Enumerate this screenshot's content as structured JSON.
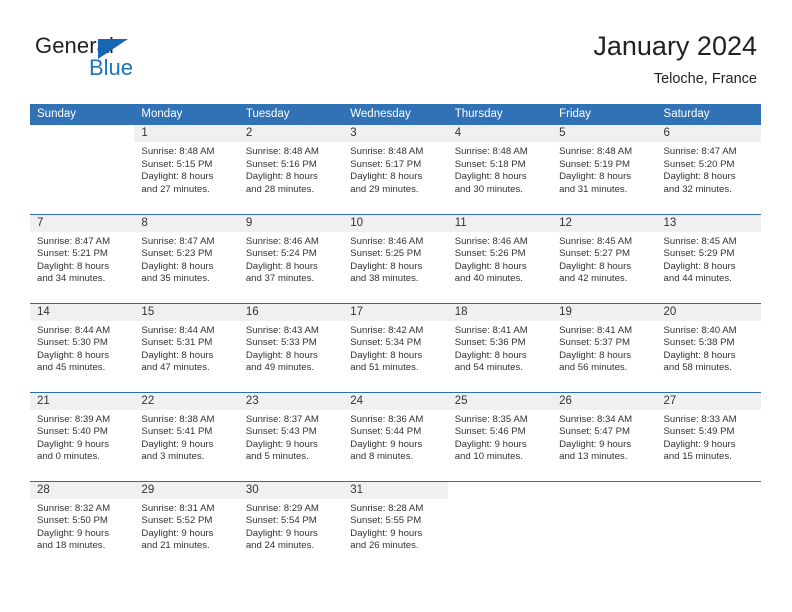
{
  "brand": {
    "name_primary": "General",
    "name_secondary": "Blue",
    "flag_color": "#1667b2",
    "secondary_color": "#1b75bb"
  },
  "header": {
    "title": "January 2024",
    "location": "Teloche, France"
  },
  "theme": {
    "header_row_bg": "#3072b5",
    "row_border": "#2a6db4",
    "daynum_band_bg": "#f0f0f0",
    "text_color": "#333333"
  },
  "weekday_headers": [
    "Sunday",
    "Monday",
    "Tuesday",
    "Wednesday",
    "Thursday",
    "Friday",
    "Saturday"
  ],
  "weeks": [
    [
      {
        "day": "",
        "sunrise": "",
        "sunset": "",
        "daylight_line1": "",
        "daylight_line2": ""
      },
      {
        "day": "1",
        "sunrise": "Sunrise: 8:48 AM",
        "sunset": "Sunset: 5:15 PM",
        "daylight_line1": "Daylight: 8 hours",
        "daylight_line2": "and 27 minutes."
      },
      {
        "day": "2",
        "sunrise": "Sunrise: 8:48 AM",
        "sunset": "Sunset: 5:16 PM",
        "daylight_line1": "Daylight: 8 hours",
        "daylight_line2": "and 28 minutes."
      },
      {
        "day": "3",
        "sunrise": "Sunrise: 8:48 AM",
        "sunset": "Sunset: 5:17 PM",
        "daylight_line1": "Daylight: 8 hours",
        "daylight_line2": "and 29 minutes."
      },
      {
        "day": "4",
        "sunrise": "Sunrise: 8:48 AM",
        "sunset": "Sunset: 5:18 PM",
        "daylight_line1": "Daylight: 8 hours",
        "daylight_line2": "and 30 minutes."
      },
      {
        "day": "5",
        "sunrise": "Sunrise: 8:48 AM",
        "sunset": "Sunset: 5:19 PM",
        "daylight_line1": "Daylight: 8 hours",
        "daylight_line2": "and 31 minutes."
      },
      {
        "day": "6",
        "sunrise": "Sunrise: 8:47 AM",
        "sunset": "Sunset: 5:20 PM",
        "daylight_line1": "Daylight: 8 hours",
        "daylight_line2": "and 32 minutes."
      }
    ],
    [
      {
        "day": "7",
        "sunrise": "Sunrise: 8:47 AM",
        "sunset": "Sunset: 5:21 PM",
        "daylight_line1": "Daylight: 8 hours",
        "daylight_line2": "and 34 minutes."
      },
      {
        "day": "8",
        "sunrise": "Sunrise: 8:47 AM",
        "sunset": "Sunset: 5:23 PM",
        "daylight_line1": "Daylight: 8 hours",
        "daylight_line2": "and 35 minutes."
      },
      {
        "day": "9",
        "sunrise": "Sunrise: 8:46 AM",
        "sunset": "Sunset: 5:24 PM",
        "daylight_line1": "Daylight: 8 hours",
        "daylight_line2": "and 37 minutes."
      },
      {
        "day": "10",
        "sunrise": "Sunrise: 8:46 AM",
        "sunset": "Sunset: 5:25 PM",
        "daylight_line1": "Daylight: 8 hours",
        "daylight_line2": "and 38 minutes."
      },
      {
        "day": "11",
        "sunrise": "Sunrise: 8:46 AM",
        "sunset": "Sunset: 5:26 PM",
        "daylight_line1": "Daylight: 8 hours",
        "daylight_line2": "and 40 minutes."
      },
      {
        "day": "12",
        "sunrise": "Sunrise: 8:45 AM",
        "sunset": "Sunset: 5:27 PM",
        "daylight_line1": "Daylight: 8 hours",
        "daylight_line2": "and 42 minutes."
      },
      {
        "day": "13",
        "sunrise": "Sunrise: 8:45 AM",
        "sunset": "Sunset: 5:29 PM",
        "daylight_line1": "Daylight: 8 hours",
        "daylight_line2": "and 44 minutes."
      }
    ],
    [
      {
        "day": "14",
        "sunrise": "Sunrise: 8:44 AM",
        "sunset": "Sunset: 5:30 PM",
        "daylight_line1": "Daylight: 8 hours",
        "daylight_line2": "and 45 minutes."
      },
      {
        "day": "15",
        "sunrise": "Sunrise: 8:44 AM",
        "sunset": "Sunset: 5:31 PM",
        "daylight_line1": "Daylight: 8 hours",
        "daylight_line2": "and 47 minutes."
      },
      {
        "day": "16",
        "sunrise": "Sunrise: 8:43 AM",
        "sunset": "Sunset: 5:33 PM",
        "daylight_line1": "Daylight: 8 hours",
        "daylight_line2": "and 49 minutes."
      },
      {
        "day": "17",
        "sunrise": "Sunrise: 8:42 AM",
        "sunset": "Sunset: 5:34 PM",
        "daylight_line1": "Daylight: 8 hours",
        "daylight_line2": "and 51 minutes."
      },
      {
        "day": "18",
        "sunrise": "Sunrise: 8:41 AM",
        "sunset": "Sunset: 5:36 PM",
        "daylight_line1": "Daylight: 8 hours",
        "daylight_line2": "and 54 minutes."
      },
      {
        "day": "19",
        "sunrise": "Sunrise: 8:41 AM",
        "sunset": "Sunset: 5:37 PM",
        "daylight_line1": "Daylight: 8 hours",
        "daylight_line2": "and 56 minutes."
      },
      {
        "day": "20",
        "sunrise": "Sunrise: 8:40 AM",
        "sunset": "Sunset: 5:38 PM",
        "daylight_line1": "Daylight: 8 hours",
        "daylight_line2": "and 58 minutes."
      }
    ],
    [
      {
        "day": "21",
        "sunrise": "Sunrise: 8:39 AM",
        "sunset": "Sunset: 5:40 PM",
        "daylight_line1": "Daylight: 9 hours",
        "daylight_line2": "and 0 minutes."
      },
      {
        "day": "22",
        "sunrise": "Sunrise: 8:38 AM",
        "sunset": "Sunset: 5:41 PM",
        "daylight_line1": "Daylight: 9 hours",
        "daylight_line2": "and 3 minutes."
      },
      {
        "day": "23",
        "sunrise": "Sunrise: 8:37 AM",
        "sunset": "Sunset: 5:43 PM",
        "daylight_line1": "Daylight: 9 hours",
        "daylight_line2": "and 5 minutes."
      },
      {
        "day": "24",
        "sunrise": "Sunrise: 8:36 AM",
        "sunset": "Sunset: 5:44 PM",
        "daylight_line1": "Daylight: 9 hours",
        "daylight_line2": "and 8 minutes."
      },
      {
        "day": "25",
        "sunrise": "Sunrise: 8:35 AM",
        "sunset": "Sunset: 5:46 PM",
        "daylight_line1": "Daylight: 9 hours",
        "daylight_line2": "and 10 minutes."
      },
      {
        "day": "26",
        "sunrise": "Sunrise: 8:34 AM",
        "sunset": "Sunset: 5:47 PM",
        "daylight_line1": "Daylight: 9 hours",
        "daylight_line2": "and 13 minutes."
      },
      {
        "day": "27",
        "sunrise": "Sunrise: 8:33 AM",
        "sunset": "Sunset: 5:49 PM",
        "daylight_line1": "Daylight: 9 hours",
        "daylight_line2": "and 15 minutes."
      }
    ],
    [
      {
        "day": "28",
        "sunrise": "Sunrise: 8:32 AM",
        "sunset": "Sunset: 5:50 PM",
        "daylight_line1": "Daylight: 9 hours",
        "daylight_line2": "and 18 minutes."
      },
      {
        "day": "29",
        "sunrise": "Sunrise: 8:31 AM",
        "sunset": "Sunset: 5:52 PM",
        "daylight_line1": "Daylight: 9 hours",
        "daylight_line2": "and 21 minutes."
      },
      {
        "day": "30",
        "sunrise": "Sunrise: 8:29 AM",
        "sunset": "Sunset: 5:54 PM",
        "daylight_line1": "Daylight: 9 hours",
        "daylight_line2": "and 24 minutes."
      },
      {
        "day": "31",
        "sunrise": "Sunrise: 8:28 AM",
        "sunset": "Sunset: 5:55 PM",
        "daylight_line1": "Daylight: 9 hours",
        "daylight_line2": "and 26 minutes."
      },
      {
        "day": "",
        "sunrise": "",
        "sunset": "",
        "daylight_line1": "",
        "daylight_line2": ""
      },
      {
        "day": "",
        "sunrise": "",
        "sunset": "",
        "daylight_line1": "",
        "daylight_line2": ""
      },
      {
        "day": "",
        "sunrise": "",
        "sunset": "",
        "daylight_line1": "",
        "daylight_line2": ""
      }
    ]
  ]
}
